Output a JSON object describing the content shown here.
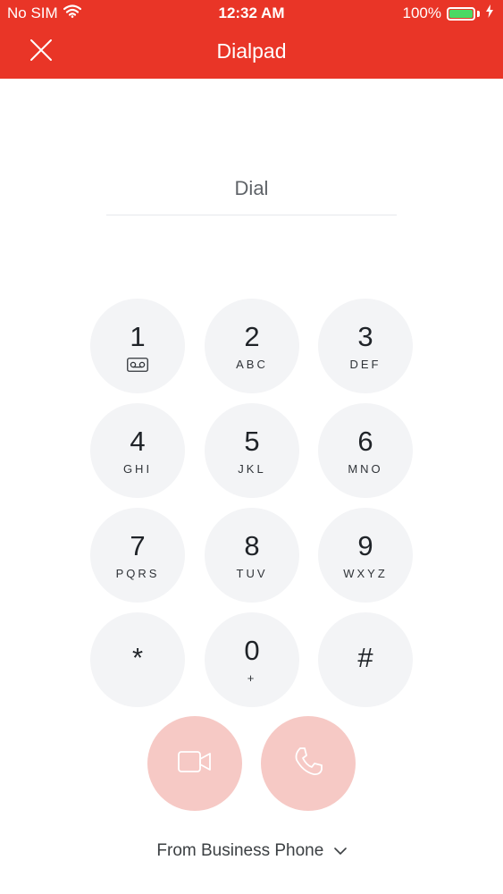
{
  "status_bar": {
    "carrier": "No SIM",
    "time": "12:32 AM",
    "battery_percent": "100%",
    "battery_level": 1.0,
    "battery_color": "#4cd964"
  },
  "header": {
    "title": "Dialpad",
    "background_color": "#e93527",
    "close_icon": "close-icon"
  },
  "dial": {
    "placeholder": "Dial"
  },
  "keypad": {
    "keys": [
      {
        "digit": "1",
        "letters": "",
        "icon": "voicemail-icon"
      },
      {
        "digit": "2",
        "letters": "ABC"
      },
      {
        "digit": "3",
        "letters": "DEF"
      },
      {
        "digit": "4",
        "letters": "GHI"
      },
      {
        "digit": "5",
        "letters": "JKL"
      },
      {
        "digit": "6",
        "letters": "MNO"
      },
      {
        "digit": "7",
        "letters": "PQRS"
      },
      {
        "digit": "8",
        "letters": "TUV"
      },
      {
        "digit": "9",
        "letters": "WXYZ"
      },
      {
        "digit": "*",
        "letters": ""
      },
      {
        "digit": "0",
        "letters": "+"
      },
      {
        "digit": "#",
        "letters": ""
      }
    ]
  },
  "actions": {
    "video_icon": "video-camera-icon",
    "call_icon": "phone-icon",
    "button_color": "#f6c9c5"
  },
  "footer": {
    "from_label": "From Business Phone",
    "chevron_icon": "chevron-down-icon"
  }
}
